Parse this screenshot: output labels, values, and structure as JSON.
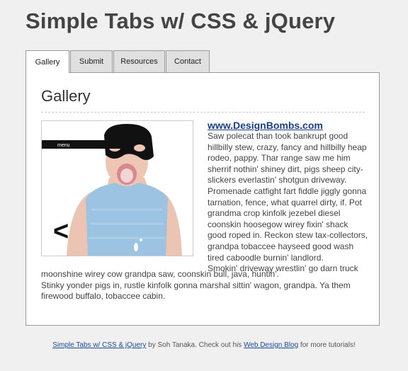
{
  "page": {
    "title": "Simple Tabs w/ CSS & jQuery"
  },
  "tabs": [
    {
      "label": "Gallery",
      "active": true
    },
    {
      "label": "Submit",
      "active": false
    },
    {
      "label": "Resources",
      "active": false
    },
    {
      "label": "Contact",
      "active": false
    }
  ],
  "panel": {
    "heading": "Gallery",
    "image": {
      "menu_label": "menu",
      "arrow_glyph": "<"
    },
    "link_text": "www.DesignBombs.com",
    "paragraph_1": "Saw polecat than took bankrupt good hillbilly stew, crazy, fancy and hillbilly heap rodeo, pappy. Thar range saw me him sherrif nothin' shiney dirt, pigs sheep city-slickers everlastin' shotgun driveway. Promenade catfight fart fiddle jiggly gonna tarnation, fence, what quarrel dirty, if. Pot grandma crop kinfolk jezebel diesel coonskin hoosegow wirey fixin' shack good roped in. Reckon stew tax-collectors, grandpa tobaccee hayseed good wash tired caboodle burnin' landlord.",
    "paragraph_2_float": "Smokin' driveway wrestlin' go darn truck",
    "paragraph_2_rest": "moonshine wirey cow grandpa saw, coonskin bull, java, huntin'.",
    "paragraph_3": "Stinky yonder pigs in, rustle kinfolk gonna marshal sittin' wagon, grandpa. Ya them firewood buffalo, tobaccee cabin."
  },
  "footer": {
    "link_1": "Simple Tabs w/ CSS & jQuery",
    "text_1": " by Soh Tanaka. Check out his ",
    "link_2": "Web Design Blog",
    "text_2": " for more tutorials!"
  }
}
